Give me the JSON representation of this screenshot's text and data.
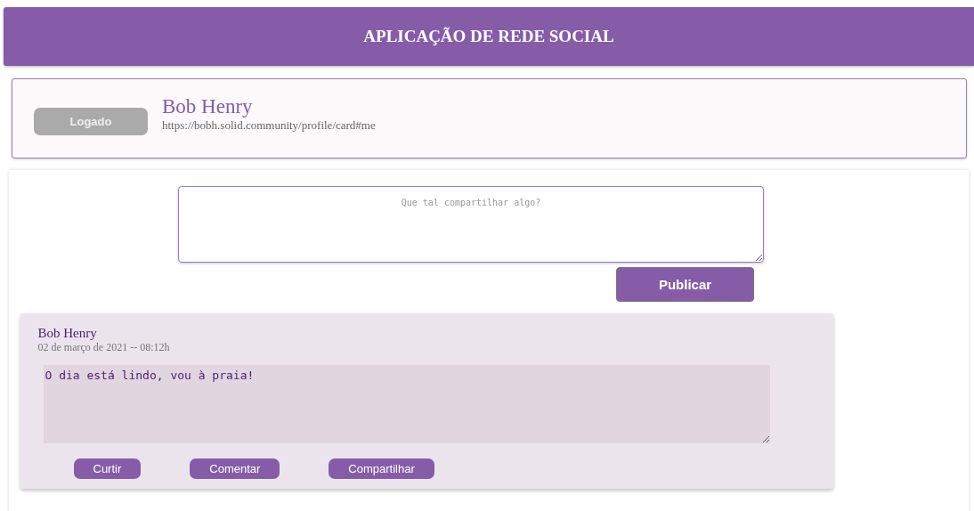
{
  "header": {
    "title": "APLICAÇÃO DE REDE SOCIAL"
  },
  "profile": {
    "status_button": "Logado",
    "name": "Bob Henry",
    "webid": "https://bobh.solid.community/profile/card#me"
  },
  "composer": {
    "placeholder": "Que tal compartilhar algo?",
    "publish_button": "Publicar"
  },
  "posts": [
    {
      "author": "Bob Henry",
      "date": "02 de março de 2021 -- 08:12h",
      "text": "O dia está lindo, vou à praia!",
      "actions": [
        "Curtir",
        "Comentar",
        "Compartilhar"
      ]
    }
  ]
}
